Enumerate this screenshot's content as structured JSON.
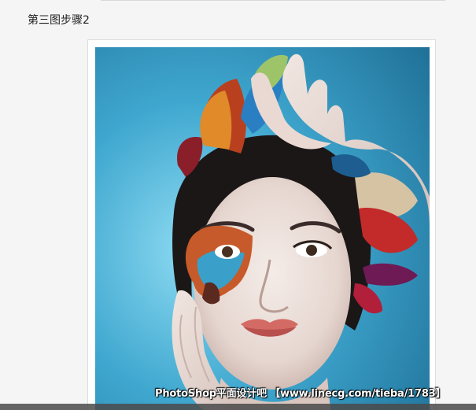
{
  "step": {
    "title": "第三图步骤2"
  },
  "image": {
    "icon": "butterfly-portrait-photo",
    "watermark": "PhotoShop平面设计吧 【www.linecg.com/tieba/1783】"
  },
  "colors": {
    "page_background": "#f5f5f5",
    "photo_background": "#2f8fb6",
    "frame": "#ffffff"
  }
}
